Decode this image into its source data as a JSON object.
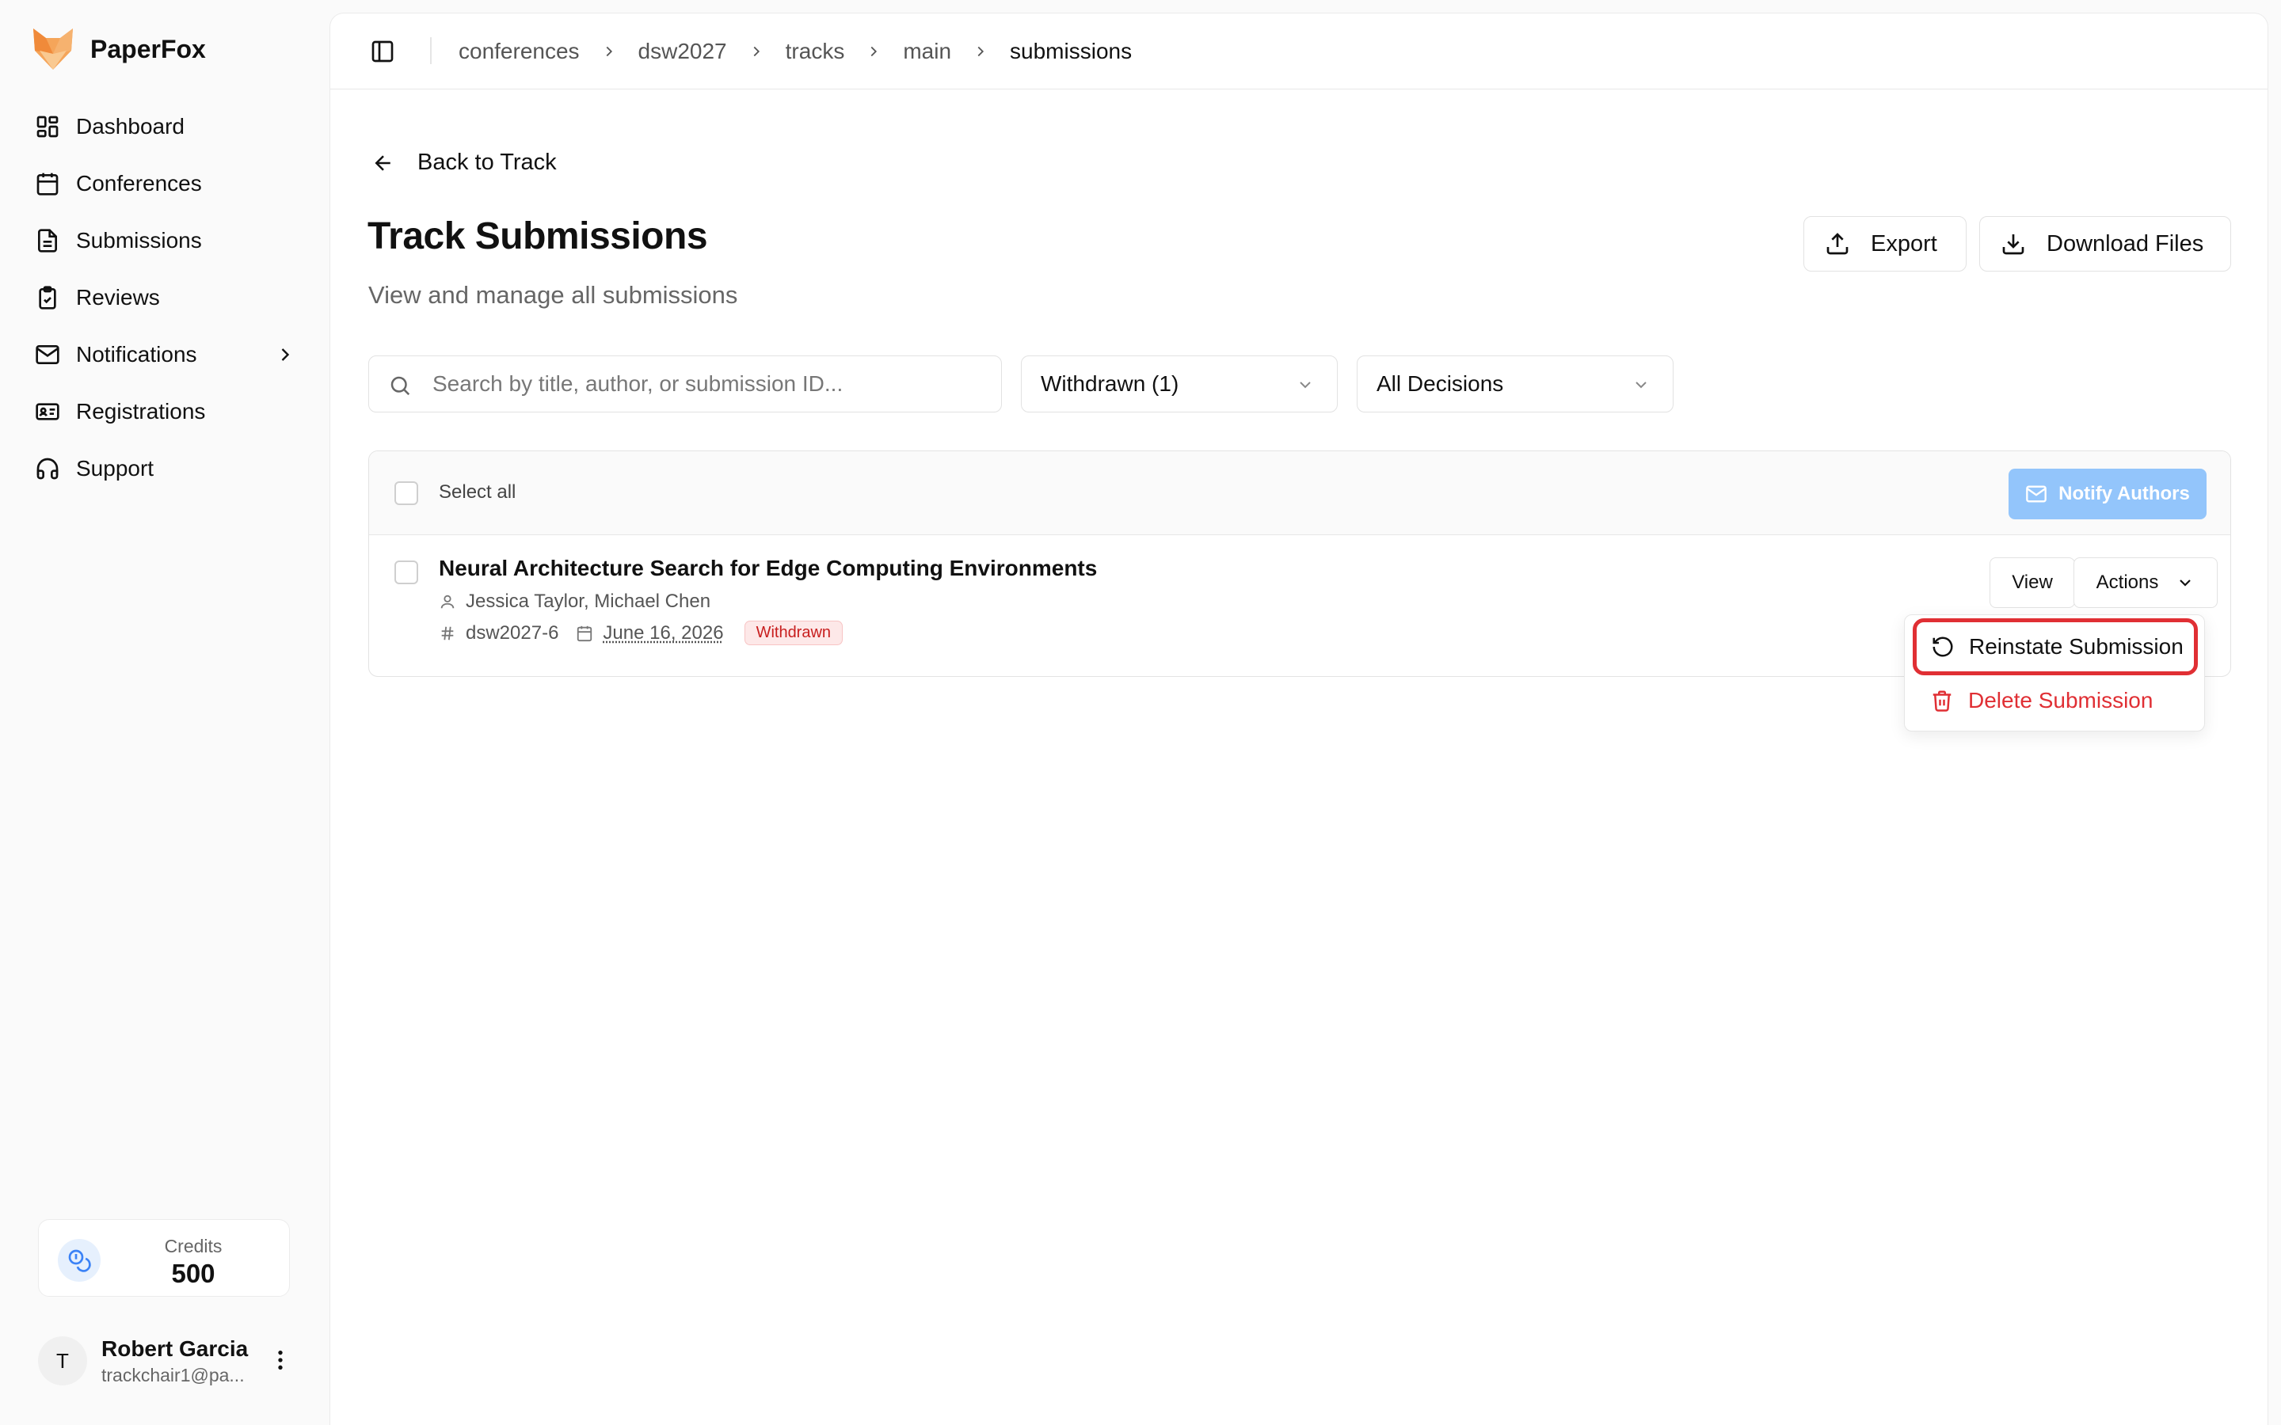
{
  "app": {
    "name": "PaperFox"
  },
  "sidebar": {
    "items": [
      {
        "label": "Dashboard",
        "icon": "dashboard-icon"
      },
      {
        "label": "Conferences",
        "icon": "calendar-icon"
      },
      {
        "label": "Submissions",
        "icon": "document-icon"
      },
      {
        "label": "Reviews",
        "icon": "clipboard-check-icon"
      },
      {
        "label": "Notifications",
        "icon": "mail-icon"
      },
      {
        "label": "Registrations",
        "icon": "id-card-icon"
      },
      {
        "label": "Support",
        "icon": "headphones-icon"
      }
    ],
    "credits": {
      "label": "Credits",
      "value": "500"
    },
    "user": {
      "initial": "T",
      "name": "Robert Garcia",
      "email": "trackchair1@pa..."
    }
  },
  "breadcrumb": [
    "conferences",
    "dsw2027",
    "tracks",
    "main",
    "submissions"
  ],
  "page": {
    "back_label": "Back to Track",
    "title": "Track Submissions",
    "subtitle": "View and manage all submissions",
    "export_label": "Export",
    "download_label": "Download Files"
  },
  "filters": {
    "search_placeholder": "Search by title, author, or submission ID...",
    "status_value": "Withdrawn (1)",
    "decision_value": "All Decisions"
  },
  "list": {
    "select_all_label": "Select all",
    "notify_label": "Notify Authors",
    "rows": [
      {
        "title": "Neural Architecture Search for Edge Computing Environments",
        "authors": "Jessica Taylor, Michael Chen",
        "id": "dsw2027-6",
        "date": "June 16, 2026",
        "status": "Withdrawn",
        "view_label": "View",
        "actions_label": "Actions"
      }
    ]
  },
  "actions_menu": {
    "reinstate_label": "Reinstate Submission",
    "delete_label": "Delete Submission"
  },
  "colors": {
    "accent_blue": "#93c5fb",
    "danger": "#e02f34",
    "badge_bg": "#fde8e8"
  }
}
